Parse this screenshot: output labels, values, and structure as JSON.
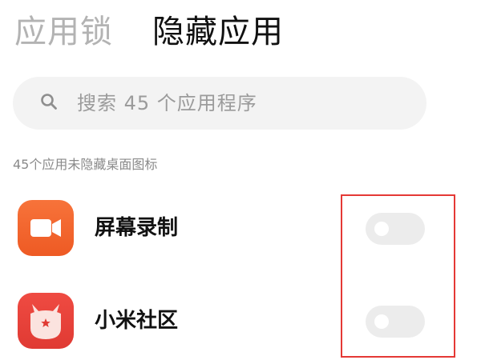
{
  "header": {
    "tabs": [
      {
        "label": "应用锁",
        "active": false
      },
      {
        "label": "隐藏应用",
        "active": true
      }
    ]
  },
  "search": {
    "placeholder": "搜索 45 个应用程序",
    "icon": "search-icon"
  },
  "section": {
    "label": "45个应用未隐藏桌面图标"
  },
  "apps": [
    {
      "name": "屏幕录制",
      "icon": "screen-recorder-icon",
      "hidden": false,
      "icon_color": "#f2622e"
    },
    {
      "name": "小米社区",
      "icon": "xiaomi-community-icon",
      "hidden": false,
      "icon_color": "#e8423b"
    }
  ],
  "colors": {
    "annotation": "#e53935",
    "toggle_off": "#ececec"
  }
}
